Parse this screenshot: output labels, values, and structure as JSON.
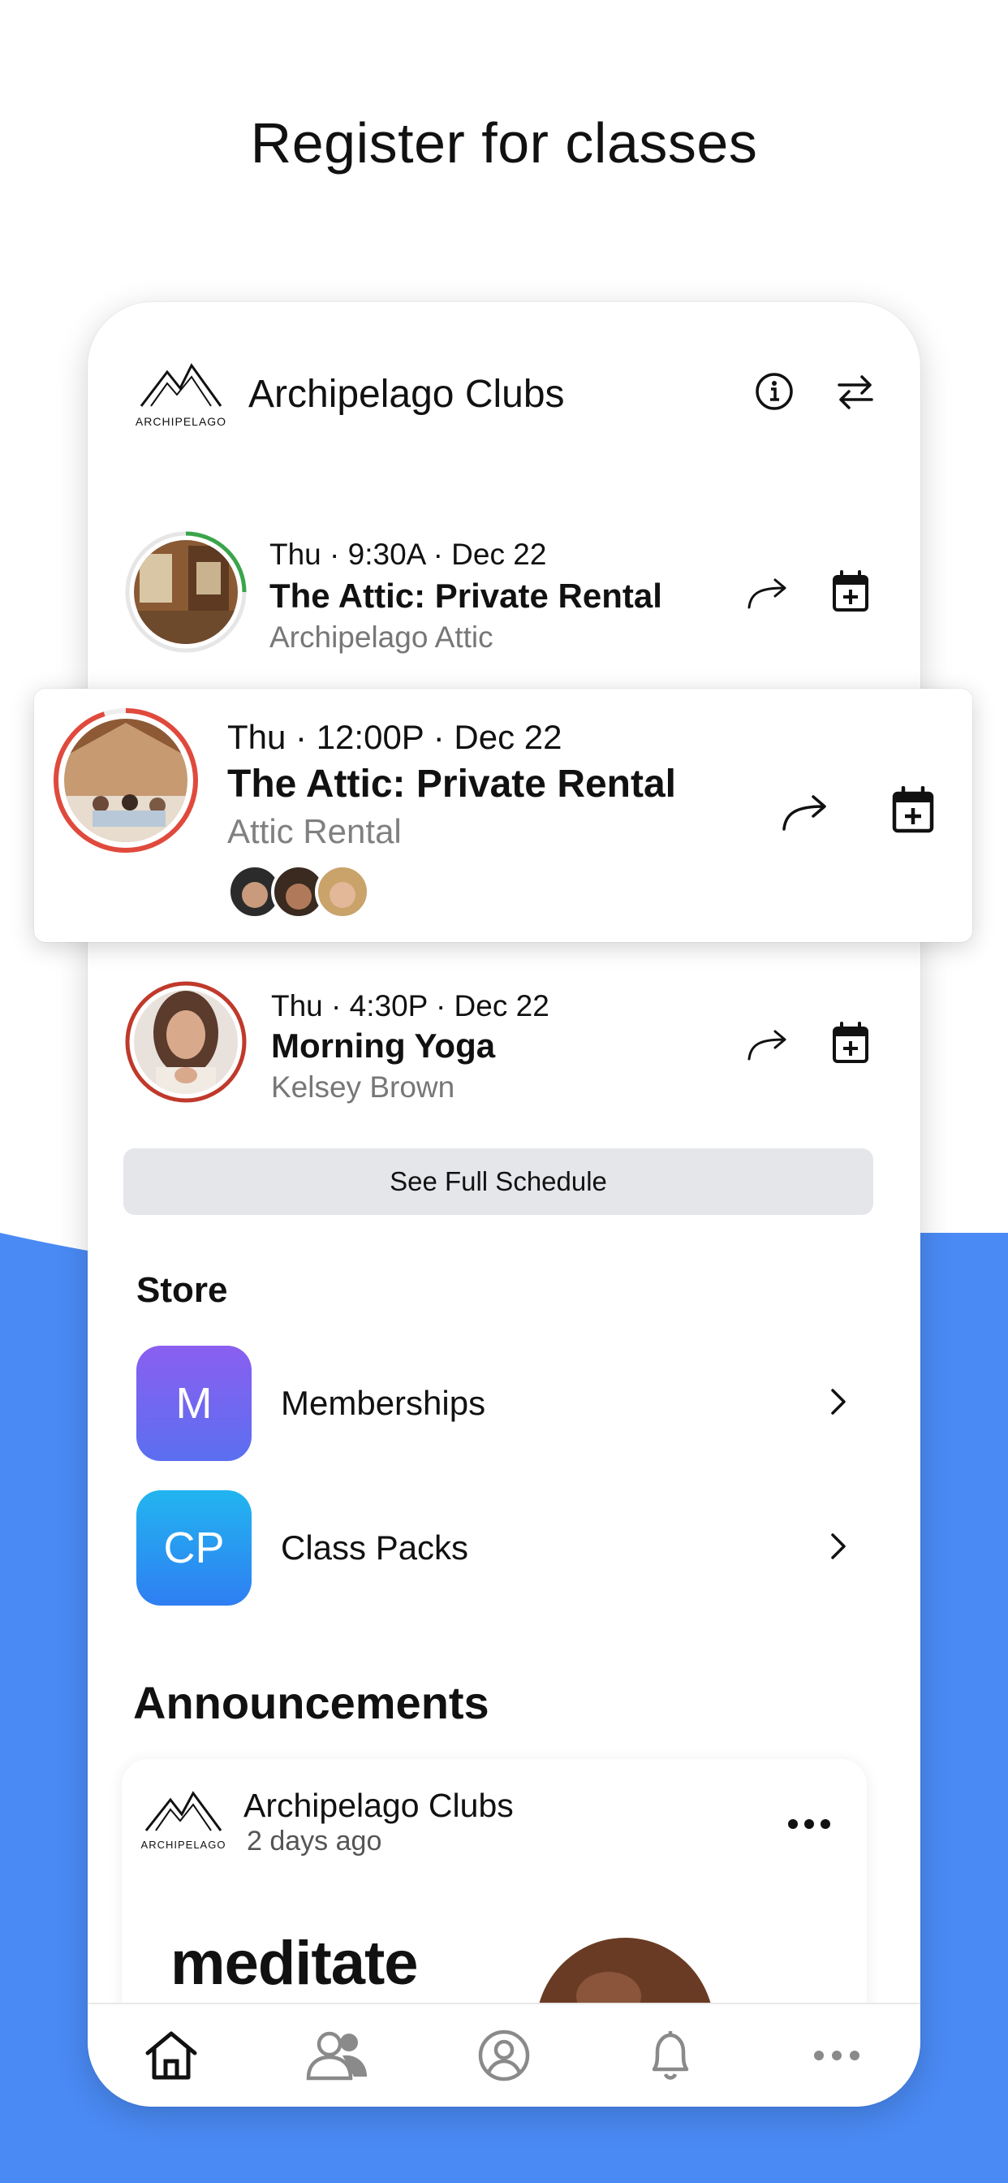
{
  "page": {
    "headline": "Register for classes",
    "accent_blue": "#4a8af4"
  },
  "club": {
    "logo_text": "ARCHIPELAGO",
    "name": "Archipelago Clubs",
    "icons": [
      "info-icon",
      "swap-icon"
    ]
  },
  "classes": [
    {
      "time": "Thu · 9:30A · Dec 22",
      "name": "The Attic: Private Rental",
      "location": "Archipelago Attic",
      "ring_color": "#3aa54a",
      "ring_fraction": 0.25
    },
    {
      "time": "Thu · 12:00P · Dec 22",
      "name": "The Attic: Private Rental",
      "location": "Attic Rental",
      "ring_color": "#e04a3c",
      "ring_fraction": 0.95,
      "attendee_count": 3
    },
    {
      "time": "Thu · 4:30P · Dec 22",
      "name": "Morning Yoga",
      "location": "Kelsey Brown",
      "ring_color": "#c0392b",
      "ring_fraction": 1.0
    }
  ],
  "schedule_button": "See Full Schedule",
  "store": {
    "title": "Store",
    "items": [
      {
        "badge": "M",
        "label": "Memberships",
        "color_top": "#8a5ff0",
        "color_bottom": "#5b6ff0"
      },
      {
        "badge": "CP",
        "label": "Class Packs",
        "color_top": "#22b5f0",
        "color_bottom": "#2f7ef2"
      }
    ]
  },
  "announcements": {
    "title": "Announcements",
    "post": {
      "author": "Archipelago Clubs",
      "time_ago": "2 days ago",
      "image_text": "meditate with"
    }
  },
  "bottom_nav": [
    "home-icon",
    "people-icon",
    "profile-icon",
    "bell-icon",
    "more-icon"
  ]
}
